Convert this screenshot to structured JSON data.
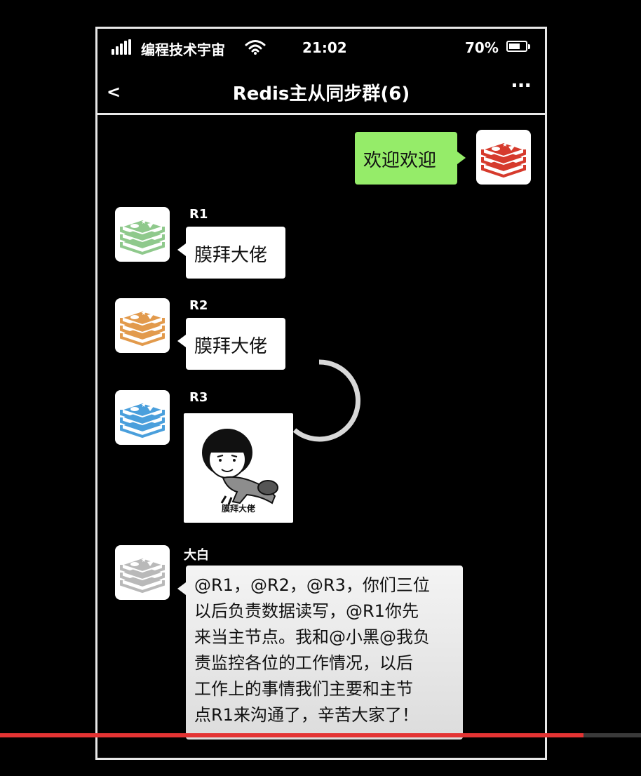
{
  "status_bar": {
    "carrier": "编程技术宇宙",
    "time": "21:02",
    "battery_percent": "70%",
    "battery_level": 0.7,
    "signal_icon": "signal-bars-icon",
    "wifi_icon": "wifi-icon",
    "battery_icon": "battery-icon"
  },
  "nav": {
    "back_label": "<",
    "title": "Redis主从同步群(6)",
    "more_label": "···"
  },
  "messages": [
    {
      "sender": "",
      "text": "欢迎欢迎",
      "outgoing": true,
      "avatar_color": "#d63a2c"
    },
    {
      "sender": "R1",
      "text": "膜拜大佬",
      "outgoing": false,
      "avatar_color": "#8fc98c"
    },
    {
      "sender": "R2",
      "text": "膜拜大佬",
      "outgoing": false,
      "avatar_color": "#e29a4c"
    },
    {
      "sender": "R3",
      "sticker_caption": "膜拜大佬",
      "outgoing": false,
      "avatar_color": "#4a9fdc"
    },
    {
      "sender": "大白",
      "outgoing": false,
      "avatar_color": "#b9b9b9",
      "lines": [
        "@R1，@R2，@R3，你们三位",
        "以后负责数据读写，@R1你先",
        "来当主节点。我和@小黑@我负",
        "责监控各位的工作情况，以后",
        "工作上的事情我们主要和主节",
        "点R1来沟通了，辛苦大家了！"
      ]
    }
  ],
  "video": {
    "played_fraction": 0.91,
    "loading_icon": "loading-spinner-icon",
    "played_color": "#e33333"
  }
}
